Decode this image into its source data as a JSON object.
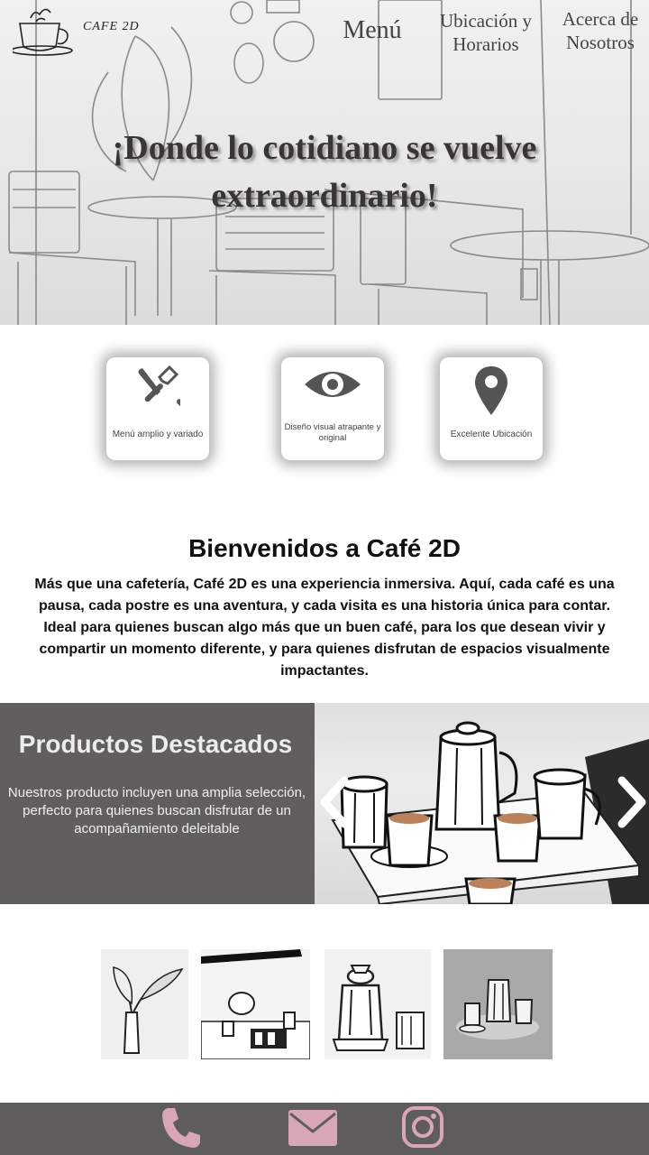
{
  "brand": {
    "logo_text": "CAFE 2D"
  },
  "nav": {
    "menu": "Menú",
    "location": "Ubicación y Horarios",
    "about": "Acerca de Nosotros"
  },
  "hero": {
    "title": "¡Donde lo cotidiano se vuelve extraordinario!"
  },
  "features": [
    {
      "label": "Menú amplio y variado",
      "icon": "fork-knife-icon"
    },
    {
      "label": "Diseño visual atrapante y original",
      "icon": "eye-icon"
    },
    {
      "label": "Excelente Ubicación",
      "icon": "location-pin-icon"
    }
  ],
  "welcome": {
    "title": "Bienvenidos a Café 2D",
    "text": "Más que una cafetería, Café 2D es una experiencia inmersiva. Aquí, cada café es una pausa, cada postre es una aventura, y cada visita es una historia única para contar. Ideal para quienes buscan algo más que un buen café, para los que desean vivir y compartir un momento diferente, y para quienes disfrutan de espacios visualmente impactantes."
  },
  "featured": {
    "title": "Productos Destacados",
    "text": "Nuestros producto incluyen una amplia selección, perfecto para quienes buscan disfrutar de un acompañamiento deleitable"
  },
  "footer": {
    "icons": [
      "phone-icon",
      "mail-icon",
      "instagram-icon"
    ]
  },
  "colors": {
    "panel_gray": "#615e5e",
    "footer_gray": "#5f5c5c",
    "footer_icon": "#d8a7b6",
    "icon_dark": "#555555"
  }
}
